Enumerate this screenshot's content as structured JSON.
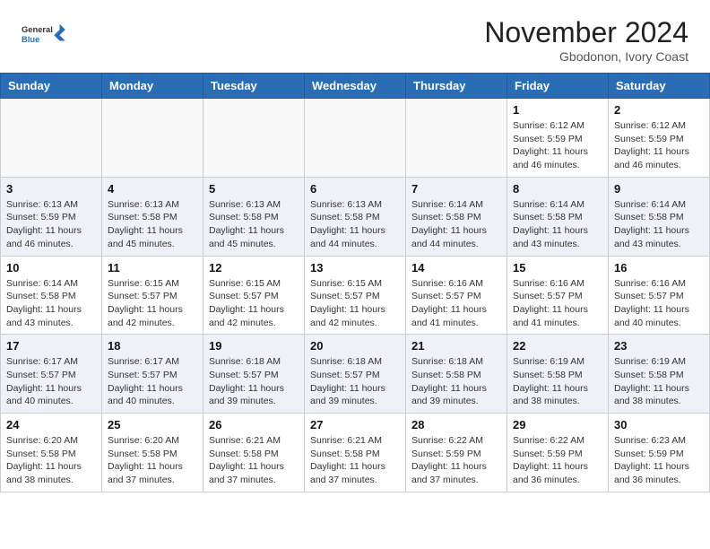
{
  "header": {
    "logo_general": "General",
    "logo_blue": "Blue",
    "month_title": "November 2024",
    "location": "Gbodonon, Ivory Coast"
  },
  "days_of_week": [
    "Sunday",
    "Monday",
    "Tuesday",
    "Wednesday",
    "Thursday",
    "Friday",
    "Saturday"
  ],
  "weeks": [
    [
      {
        "day": "",
        "empty": true
      },
      {
        "day": "",
        "empty": true
      },
      {
        "day": "",
        "empty": true
      },
      {
        "day": "",
        "empty": true
      },
      {
        "day": "",
        "empty": true
      },
      {
        "day": "1",
        "sunrise": "6:12 AM",
        "sunset": "5:59 PM",
        "daylight": "11 hours and 46 minutes."
      },
      {
        "day": "2",
        "sunrise": "6:12 AM",
        "sunset": "5:59 PM",
        "daylight": "11 hours and 46 minutes."
      }
    ],
    [
      {
        "day": "3",
        "sunrise": "6:13 AM",
        "sunset": "5:59 PM",
        "daylight": "11 hours and 46 minutes."
      },
      {
        "day": "4",
        "sunrise": "6:13 AM",
        "sunset": "5:58 PM",
        "daylight": "11 hours and 45 minutes."
      },
      {
        "day": "5",
        "sunrise": "6:13 AM",
        "sunset": "5:58 PM",
        "daylight": "11 hours and 45 minutes."
      },
      {
        "day": "6",
        "sunrise": "6:13 AM",
        "sunset": "5:58 PM",
        "daylight": "11 hours and 44 minutes."
      },
      {
        "day": "7",
        "sunrise": "6:14 AM",
        "sunset": "5:58 PM",
        "daylight": "11 hours and 44 minutes."
      },
      {
        "day": "8",
        "sunrise": "6:14 AM",
        "sunset": "5:58 PM",
        "daylight": "11 hours and 43 minutes."
      },
      {
        "day": "9",
        "sunrise": "6:14 AM",
        "sunset": "5:58 PM",
        "daylight": "11 hours and 43 minutes."
      }
    ],
    [
      {
        "day": "10",
        "sunrise": "6:14 AM",
        "sunset": "5:58 PM",
        "daylight": "11 hours and 43 minutes."
      },
      {
        "day": "11",
        "sunrise": "6:15 AM",
        "sunset": "5:57 PM",
        "daylight": "11 hours and 42 minutes."
      },
      {
        "day": "12",
        "sunrise": "6:15 AM",
        "sunset": "5:57 PM",
        "daylight": "11 hours and 42 minutes."
      },
      {
        "day": "13",
        "sunrise": "6:15 AM",
        "sunset": "5:57 PM",
        "daylight": "11 hours and 42 minutes."
      },
      {
        "day": "14",
        "sunrise": "6:16 AM",
        "sunset": "5:57 PM",
        "daylight": "11 hours and 41 minutes."
      },
      {
        "day": "15",
        "sunrise": "6:16 AM",
        "sunset": "5:57 PM",
        "daylight": "11 hours and 41 minutes."
      },
      {
        "day": "16",
        "sunrise": "6:16 AM",
        "sunset": "5:57 PM",
        "daylight": "11 hours and 40 minutes."
      }
    ],
    [
      {
        "day": "17",
        "sunrise": "6:17 AM",
        "sunset": "5:57 PM",
        "daylight": "11 hours and 40 minutes."
      },
      {
        "day": "18",
        "sunrise": "6:17 AM",
        "sunset": "5:57 PM",
        "daylight": "11 hours and 40 minutes."
      },
      {
        "day": "19",
        "sunrise": "6:18 AM",
        "sunset": "5:57 PM",
        "daylight": "11 hours and 39 minutes."
      },
      {
        "day": "20",
        "sunrise": "6:18 AM",
        "sunset": "5:57 PM",
        "daylight": "11 hours and 39 minutes."
      },
      {
        "day": "21",
        "sunrise": "6:18 AM",
        "sunset": "5:58 PM",
        "daylight": "11 hours and 39 minutes."
      },
      {
        "day": "22",
        "sunrise": "6:19 AM",
        "sunset": "5:58 PM",
        "daylight": "11 hours and 38 minutes."
      },
      {
        "day": "23",
        "sunrise": "6:19 AM",
        "sunset": "5:58 PM",
        "daylight": "11 hours and 38 minutes."
      }
    ],
    [
      {
        "day": "24",
        "sunrise": "6:20 AM",
        "sunset": "5:58 PM",
        "daylight": "11 hours and 38 minutes."
      },
      {
        "day": "25",
        "sunrise": "6:20 AM",
        "sunset": "5:58 PM",
        "daylight": "11 hours and 37 minutes."
      },
      {
        "day": "26",
        "sunrise": "6:21 AM",
        "sunset": "5:58 PM",
        "daylight": "11 hours and 37 minutes."
      },
      {
        "day": "27",
        "sunrise": "6:21 AM",
        "sunset": "5:58 PM",
        "daylight": "11 hours and 37 minutes."
      },
      {
        "day": "28",
        "sunrise": "6:22 AM",
        "sunset": "5:59 PM",
        "daylight": "11 hours and 37 minutes."
      },
      {
        "day": "29",
        "sunrise": "6:22 AM",
        "sunset": "5:59 PM",
        "daylight": "11 hours and 36 minutes."
      },
      {
        "day": "30",
        "sunrise": "6:23 AM",
        "sunset": "5:59 PM",
        "daylight": "11 hours and 36 minutes."
      }
    ]
  ]
}
